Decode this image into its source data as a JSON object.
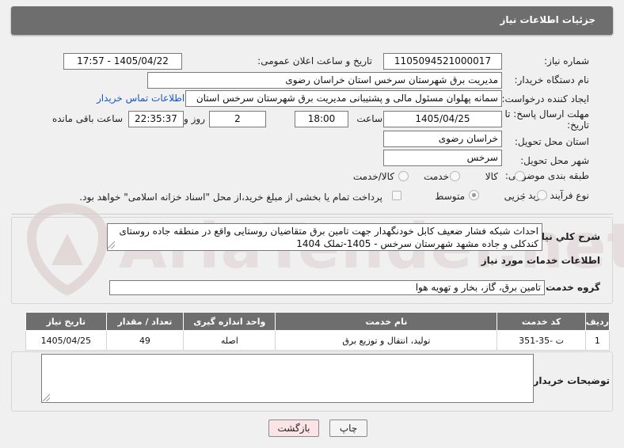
{
  "header": {
    "title": "جزئیات اطلاعات نیاز"
  },
  "form": {
    "need_number_label": "شماره نیاز:",
    "need_number": "1105094521000017",
    "announce_label": "تاریخ و ساعت اعلان عمومی:",
    "announce_value": "1405/04/22 - 17:57",
    "buyer_org_label": "نام دستگاه خریدار:",
    "buyer_org": "مدیریت برق شهرستان سرخس استان خراسان رضوی",
    "creator_label": "ایجاد کننده درخواست:",
    "creator": "سمانه پهلوان مسئول مالی و پشتیبانی مدیریت برق شهرستان سرخس استان",
    "contact_link": "اطلاعات تماس خریدار",
    "deadline_label_1": "مهلت ارسال پاسخ: تا",
    "deadline_label_2": "تاریخ:",
    "deadline_date": "1405/04/25",
    "time_label": "ساعت",
    "deadline_time": "18:00",
    "days_value": "2",
    "days_label": "روز و",
    "remaining_value": "22:35:37",
    "remaining_label": "ساعت باقی مانده",
    "province_label": "استان محل تحویل:",
    "province": "خراسان رضوی",
    "city_label": "شهر محل تحویل:",
    "city": "سرخس",
    "category_label": "طبقه بندی موضوعی:",
    "category_options": [
      "کالا",
      "خدمت",
      "کالا/خدمت"
    ],
    "process_label": "نوع فرآیند خرید :",
    "process_options": [
      "جزیی",
      "متوسط"
    ],
    "payment_note": "پرداخت تمام یا بخشی از مبلغ خرید،از محل \"اسناد خزانه اسلامی\" خواهد بود."
  },
  "description": {
    "label": "شرح كلي نياز:",
    "text": "احداث شبکه فشار ضعیف کابل خودنگهدار جهت تامین برق متقاضیان روستایی واقع در منطقه جاده روستای کندکلی و جاده مشهد شهرستان سرخس - 1405-تملک 1404"
  },
  "services": {
    "heading": "اطلاعات خدمات مورد نیاز",
    "group_label": "گروه خدمت:",
    "group_value": "تامین برق، گاز، بخار و تهویه هوا",
    "columns": [
      "ردیف",
      "کد خدمت",
      "نام خدمت",
      "واحد اندازه گیری",
      "تعداد / مقدار",
      "تاریخ نیاز"
    ],
    "rows": [
      [
        "1",
        "ت -35-351",
        "تولید، انتقال و توزیع برق",
        "اصله",
        "49",
        "1405/04/25"
      ]
    ]
  },
  "buyer_notes": {
    "label": "توضیحات خریدار:",
    "text": ""
  },
  "buttons": {
    "print": "چاپ",
    "back": "بازگشت"
  },
  "watermark": {
    "text": "AriaTender.net"
  }
}
